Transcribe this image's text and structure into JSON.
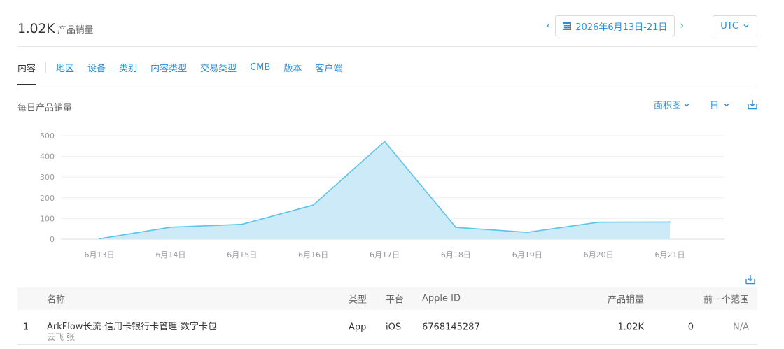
{
  "header": {
    "total_value": "1.02K",
    "total_label": "产品销量",
    "date_range": "2026年6月13日-21日",
    "timezone": "UTC",
    "prev_icon": "chevron-left-icon",
    "next_icon": "chevron-right-icon",
    "calendar_icon": "calendar-icon"
  },
  "tabs": [
    {
      "label": "内容",
      "active": true
    },
    {
      "label": "地区"
    },
    {
      "label": "设备"
    },
    {
      "label": "类别"
    },
    {
      "label": "内容类型"
    },
    {
      "label": "交易类型"
    },
    {
      "label": "CMB"
    },
    {
      "label": "版本"
    },
    {
      "label": "客户端"
    }
  ],
  "chart_header": {
    "title": "每日产品销量",
    "chart_type_label": "面积图",
    "period_label": "日",
    "download_icon": "download-icon"
  },
  "chart_data": {
    "type": "area",
    "categories": [
      "6月13日",
      "6月14日",
      "6月15日",
      "6月16日",
      "6月17日",
      "6月18日",
      "6月19日",
      "6月20日",
      "6月21日"
    ],
    "series": [
      {
        "values": [
          2,
          58,
          72,
          165,
          472,
          57,
          33,
          82,
          83
        ]
      }
    ],
    "ylim": [
      0,
      500
    ],
    "yticks": [
      0,
      100,
      200,
      300,
      400,
      500
    ],
    "grid": true,
    "line_color": "#5ac4ea",
    "fill_color": "#cdeaf8"
  },
  "table": {
    "download_icon": "download-icon",
    "columns": {
      "name": "名称",
      "type": "类型",
      "platform": "平台",
      "apple_id": "Apple ID",
      "units": "产品销量",
      "previous": "前一个范围"
    },
    "rows": [
      {
        "index": "1",
        "name": "ArkFlow长流-信用卡银行卡管理-数字卡包",
        "developer": "云飞 张",
        "type": "App",
        "platform": "iOS",
        "apple_id": "6768145287",
        "units": "1.02K",
        "previous": "0",
        "change": "N/A"
      }
    ]
  }
}
